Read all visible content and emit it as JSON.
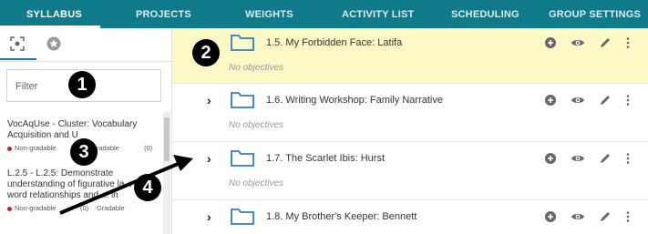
{
  "nav": {
    "tabs": [
      "SYLLABUS",
      "PROJECTS",
      "WEIGHTS",
      "ACTIVITY LIST",
      "SCHEDULING",
      "GROUP SETTINGS"
    ],
    "active": "SYLLABUS"
  },
  "sidebar": {
    "tab_icons": [
      "scan-icon",
      "star-icon"
    ],
    "filter_placeholder": "Filter",
    "standards": [
      {
        "title": "VocAqUse - Cluster: Vocabulary Acquisition and U...",
        "line1": "VocAqUse - Cluster: Vocabulary",
        "line2": "Acquisition and U",
        "status": "Non-gradable",
        "gradable": "Gradable",
        "count": "(0)"
      },
      {
        "line1": "L.2.5 - L.2.5: Demonstrate",
        "line2": "understanding of figurative la...",
        "line3": "word relationships and ... in",
        "status": "Non-gradable",
        "count": "(0)",
        "gradable": "Gradable"
      }
    ]
  },
  "rows": [
    {
      "title": "1.5. My Forbidden Face: Latifa",
      "note": "No objectives",
      "highlighted": true
    },
    {
      "title": "1.6. Writing Workshop: Family Narrative",
      "note": "No objectives",
      "highlighted": false
    },
    {
      "title": "1.7. The Scarlet Ibis: Hurst",
      "note": "No objectives",
      "highlighted": false
    },
    {
      "title": "1.8. My Brother's Keeper: Bennett",
      "note": "",
      "highlighted": false
    }
  ],
  "row_actions": [
    "add-icon",
    "view-icon",
    "edit-icon",
    "more-icon"
  ],
  "annotations": [
    "1",
    "2",
    "3",
    "4"
  ],
  "colors": {
    "nav": "#0e7a8a",
    "highlight": "#fdf9c6",
    "folder": "#2f7fb8",
    "accent": "#1a73a8"
  }
}
